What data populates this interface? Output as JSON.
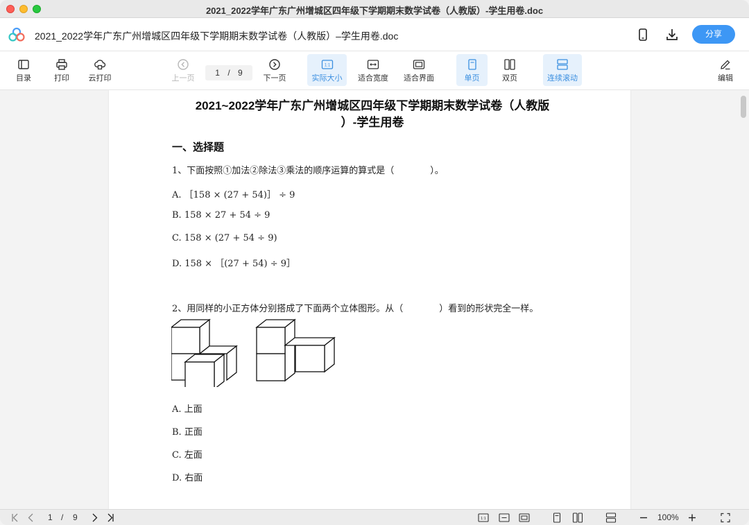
{
  "window": {
    "title": "2021_2022学年广东广州增城区四年级下学期期末数学试卷（人教版）-学生用卷.doc"
  },
  "header": {
    "doc_title": "2021_2022学年广东广州增城区四年级下学期期末数学试卷（人教版）–学生用卷.doc",
    "share_label": "分享"
  },
  "toolbar": {
    "toc": "目录",
    "print": "打印",
    "cloud_print": "云打印",
    "prev_page": "上一页",
    "page_current": "1",
    "page_sep": "/",
    "page_total": "9",
    "next_page": "下一页",
    "actual_size": "实际大小",
    "fit_width": "适合宽度",
    "fit_screen": "适合界面",
    "single_page": "单页",
    "double_page": "双页",
    "continuous": "连续滚动",
    "edit": "编辑",
    "icon_badge": "1:1"
  },
  "document": {
    "title_line1": "2021~2022学年广东广州增城区四年级下学期期末数学试卷（人教版",
    "title_line2": "）-学生用卷",
    "section1": "一、选择题",
    "q1": {
      "text": "1、下面按照①加法②除法③乘法的顺序运算的算式是（　　　　）。",
      "options": [
        "A. ［158 × (27 + 54)］ ÷ 9",
        "B. 158 × 27 + 54 ÷ 9",
        "C. 158 × (27 + 54 ÷ 9)",
        "D. 158 × ［(27 + 54) ÷ 9］"
      ]
    },
    "q2": {
      "text": "2、用同样的小正方体分别搭成了下面两个立体图形。从（　　　　）看到的形状完全一样。",
      "options": [
        "A. 上面",
        "B. 正面",
        "C. 左面",
        "D. 右面"
      ]
    }
  },
  "statusbar": {
    "page_current": "1",
    "page_sep": "/",
    "page_total": "9",
    "zoom": "100%",
    "icon_badge": "1:1"
  },
  "colors": {
    "accent": "#3d97f5",
    "active_bg": "#e6f1fc",
    "active_text": "#3b8fe0"
  }
}
